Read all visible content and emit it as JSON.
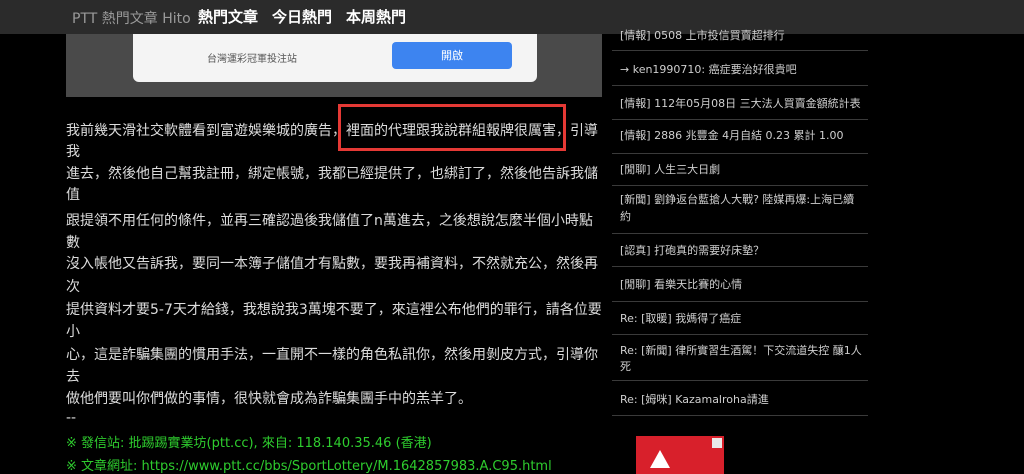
{
  "nav": {
    "brand": "PTT 熱門文章 Hito",
    "links": [
      "熱門文章",
      "今日熱門",
      "本周熱門"
    ]
  },
  "ad": {
    "text": "台灣運彩冠軍投注站",
    "button": "開啟"
  },
  "post": {
    "lines": [
      "我前幾天滑社交軟體看到富遊娛樂城的廣告，裡面的代理跟我說群組報牌很厲害，引導",
      "我",
      "進去，然後他自己幫我註冊，綁定帳號，我都已經提供了，也綁訂了，然後他告訴我儲",
      "值",
      "跟提領不用任何的條件，並再三確認過後我儲值了n萬進去，之後想說怎麼半個小時點",
      "數",
      "沒入帳他又告訴我，要同一本簿子儲值才有點數，要我再補資料，不然就充公，然後再",
      "次",
      "提供資料才要5-7天才給錢，我想說我3萬塊不要了，來這裡公布他們的罪行，請各位要",
      "小",
      "心，這是詐騙集團的慣用手法，一直開不一樣的角色私訊你，然後用剝皮方式，引導你",
      "去",
      "做他們要叫你們做的事情，很快就會成為詐騙集團手中的羔羊了。",
      "--"
    ],
    "signature": [
      "※ 發信站: 批踢踢實業坊(ptt.cc), 來自: 118.140.35.46 (香港)",
      "※ 文章網址: https://www.ptt.cc/bbs/SportLottery/M.1642857983.A.C95.html"
    ]
  },
  "sidebar": {
    "items": [
      "[情報] 0508 上市投信買賣超排行",
      "→ ken1990710: 癌症要治好很貴吧",
      "[情報] 112年05月08日 三大法人買賣金額統計表",
      "[情報] 2886 兆豐金 4月自結 0.23 累計 1.00",
      "[閒聊] 人生三大日劇",
      "[新聞] 劉錚返台藍搶人大戰? 陸媒再爆:上海已續",
      "約",
      "[認真] 打砲真的需要好床墊？",
      "[閒聊] 看樂天比賽的心情",
      "Re: [取暖] 我媽得了癌症",
      "Re: [新聞] 律所實習生酒駕！下交流道失控 釀1人",
      "死",
      "Re: [姆咪] Kazamalroha請進"
    ]
  },
  "colors": {
    "highlight_border": "#e53935",
    "signature_text": "#2ecc2e",
    "ad_button": "#3d84f0"
  }
}
